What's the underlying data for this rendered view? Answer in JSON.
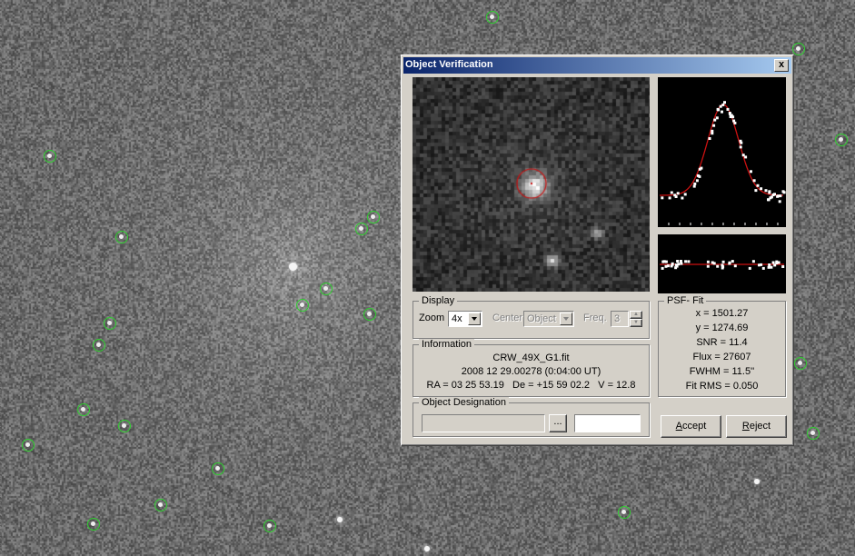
{
  "window": {
    "title": "Object Verification",
    "close_label": "x"
  },
  "display": {
    "legend": "Display",
    "zoom_label": "Zoom",
    "zoom_value": "4x",
    "center_label": "Center",
    "center_value": "Object",
    "freq_label": "Freq.",
    "freq_value": "3"
  },
  "information": {
    "legend": "Information",
    "filename": "CRW_49X_G1.fit",
    "datetime": "2008 12 29.00278 (0:04:00 UT)",
    "coords": "RA = 03 25 53.19   De = +15 59 02.2   V = 12.8"
  },
  "designation": {
    "legend": "Object Designation",
    "field1_value": "",
    "field2_value": "",
    "browse_label": "..."
  },
  "psf_fit": {
    "legend": "PSF- Fit",
    "x": "x = 1501.27",
    "y": "y = 1274.69",
    "snr": "SNR = 11.4",
    "flux": "Flux = 27607",
    "fwhm": "FWHM = 11.5''",
    "fit_rms": "Fit RMS = 0.050"
  },
  "buttons": {
    "accept_pre": "",
    "accept_key": "A",
    "accept_post": "ccept",
    "reject_pre": "",
    "reject_key": "R",
    "reject_post": "eject"
  },
  "colors": {
    "marker": "#2fd12f",
    "fit_curve": "#cc1111",
    "titlebar_start": "#0a246a",
    "titlebar_end": "#a6caf0"
  }
}
